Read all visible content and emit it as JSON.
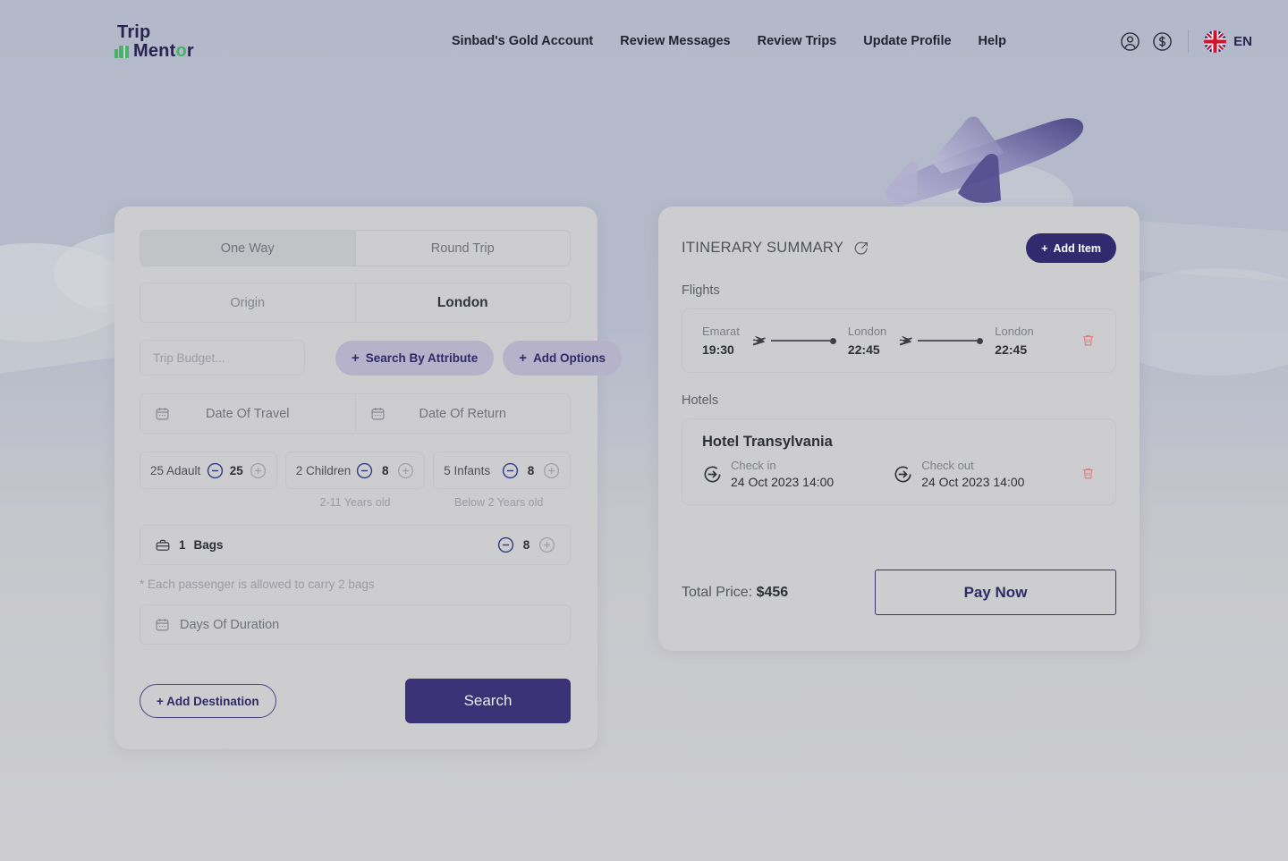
{
  "header": {
    "logo": {
      "line1": "Trip",
      "line2_pre": "Ment",
      "line2_accent": "o",
      "line2_post": "r"
    },
    "nav": [
      {
        "label": "Sinbad's Gold Account"
      },
      {
        "label": "Review Messages"
      },
      {
        "label": "Review Trips"
      },
      {
        "label": "Update Profile"
      },
      {
        "label": "Help"
      }
    ],
    "account_icon": "user-circle-icon",
    "currency_icon": "dollar-circle-icon",
    "language": {
      "flag": "uk-flag-icon",
      "label": "EN"
    }
  },
  "search_form": {
    "trip_type": {
      "one_way": "One Way",
      "round_trip": "Round Trip",
      "selected": "One Way"
    },
    "route": {
      "origin_placeholder": "Origin",
      "destination_value": "London"
    },
    "budget": {
      "placeholder": "Trip Budget...",
      "value": ""
    },
    "search_by_attribute": "Search By Attribute",
    "add_options": "Add Options",
    "dates": {
      "travel_placeholder": "Date Of Travel",
      "return_placeholder": "Date Of Return"
    },
    "passengers": [
      {
        "label": "25 Adault",
        "value": "25",
        "hint": ""
      },
      {
        "label": "2 Children",
        "value": "8",
        "hint": "2-11 Years old"
      },
      {
        "label": "5 Infants",
        "value": "8",
        "hint": "Below 2 Years old"
      }
    ],
    "bags": {
      "count": "1",
      "label": "Bags",
      "value": "8"
    },
    "bags_note": "* Each passenger is allowed to carry 2 bags",
    "duration_placeholder": "Days Of Duration",
    "add_destination": "+ Add Destination",
    "search_button": "Search"
  },
  "itinerary": {
    "title": "ITINERARY SUMMARY",
    "edit_icon": "external-link-circle-icon",
    "add_item": "Add Item",
    "flights_label": "Flights",
    "flight_stops": [
      {
        "city": "Emarat",
        "time": "19:30"
      },
      {
        "city": "London",
        "time": "22:45"
      },
      {
        "city": "London",
        "time": "22:45"
      }
    ],
    "hotels_label": "Hotels",
    "hotel": {
      "name": "Hotel Transylvania",
      "check_in_label": "Check in",
      "check_in_value": "24 Oct 2023 14:00",
      "check_out_label": "Check out",
      "check_out_value": "24 Oct 2023 14:00"
    },
    "total_prefix": "Total Price: ",
    "total_value": "$456",
    "pay_button": "Pay Now"
  },
  "colors": {
    "brand_purple": "#322a6e",
    "accent_green": "#46b26a",
    "danger_red": "#e07a7a",
    "card_bg": "#cdcdd0"
  }
}
